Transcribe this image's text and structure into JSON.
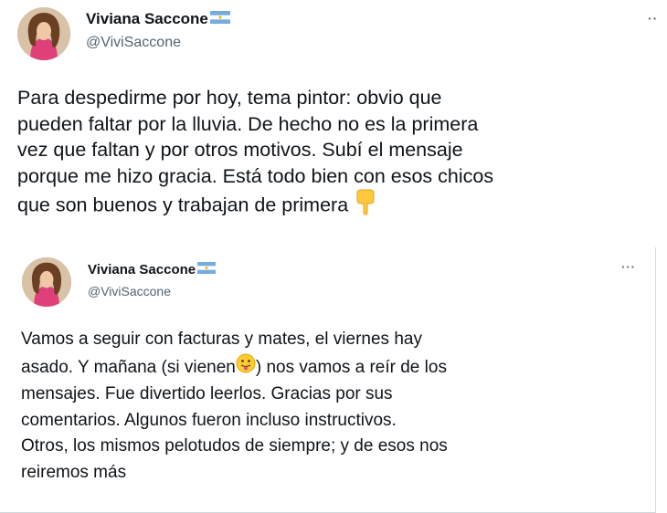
{
  "tweet": {
    "author_name": "Viviana Saccone",
    "author_handle": "@ViviSaccone",
    "more_icon": "more-dots-icon",
    "flag_icon": "argentina-flag-icon",
    "text_lines": [
      "Para despedirme por hoy, tema pintor: obvio que",
      "pueden faltar por la lluvia. De hecho no es la primera",
      "vez que faltan y por otros motivos. Subí el mensaje",
      "porque me hizo gracia.  Está todo bien con esos chicos",
      "que son buenos y trabajan de primera"
    ],
    "end_emoji": "pointing-down-hand-emoji"
  },
  "quoted_tweet": {
    "author_name": "Viviana Saccone",
    "author_handle": "@ViviSaccone",
    "more_icon": "more-dots-icon",
    "flag_icon": "argentina-flag-icon",
    "line1": "Vamos a seguir con facturas y mates, el viernes hay",
    "line2_before": "asado. Y mañana (si vienen",
    "line2_emoji": "tongue-out-face-emoji",
    "line2_after": ") nos vamos a reír de los",
    "line3": "mensajes. Fue divertido leerlos. Gracias por sus",
    "line4": "comentarios. Algunos fueron incluso instructivos.",
    "line5": "Otros, los mismos pelotudos de siempre; y de esos nos",
    "line6": "reiremos más"
  },
  "colors": {
    "text": "#0f1419",
    "secondary": "#536471",
    "border": "#cfd9de",
    "flag_blue": "#74acdf"
  }
}
